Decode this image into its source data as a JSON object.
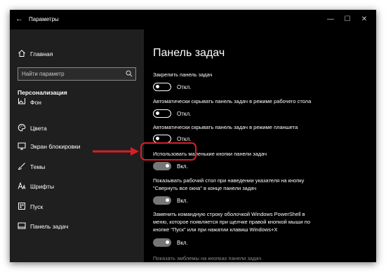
{
  "window": {
    "title": "Параметры",
    "back_icon": "back-arrow-icon",
    "caption_icons": [
      "minimize-icon",
      "maximize-icon",
      "close-icon"
    ]
  },
  "sidebar": {
    "home": {
      "label": "Главная",
      "icon": "home-icon"
    },
    "search_placeholder": "Найти параметр",
    "section": "Персонализация",
    "items": [
      {
        "label": "Фон",
        "icon": "picture-icon"
      },
      {
        "label": "Цвета",
        "icon": "palette-icon"
      },
      {
        "label": "Экран блокировки",
        "icon": "lock-screen-icon"
      },
      {
        "label": "Темы",
        "icon": "brush-icon"
      },
      {
        "label": "Шрифты",
        "icon": "fonts-icon"
      },
      {
        "label": "Пуск",
        "icon": "start-icon"
      },
      {
        "label": "Панель задач",
        "icon": "taskbar-icon"
      }
    ]
  },
  "main": {
    "title": "Панель задач",
    "options": [
      {
        "label": "Закрепить панель задач",
        "state": "Откл.",
        "on": false
      },
      {
        "label": "Автоматически скрывать панель задач в режиме рабочего стола",
        "state": "Откл.",
        "on": false
      },
      {
        "label": "Автоматически скрывать панель задач в режиме планшета",
        "state": "Откл.",
        "on": false
      },
      {
        "label": "Использовать маленькие кнопки панели задач",
        "state": "Вкл.",
        "on": true
      },
      {
        "label_lines": [
          "Показывать рабочий стол при наведении указателя на кнопку",
          "\"Свернуть все окна\" в конце панели задач"
        ],
        "state": "Вкл.",
        "on": true
      },
      {
        "label_lines": [
          "Заменить командную строку оболочкой Windows PowerShell в",
          "меню, которое появляется при щелчке правой кнопкой мыши по",
          "кнопке \"Пуск\" или при нажатии клавиш Windows+X"
        ],
        "state": "Вкл.",
        "on": true
      },
      {
        "label": "Показать эмблемы на кнопках панели задач"
      }
    ]
  },
  "annotation": {
    "highlight_color": "#d71f26"
  }
}
